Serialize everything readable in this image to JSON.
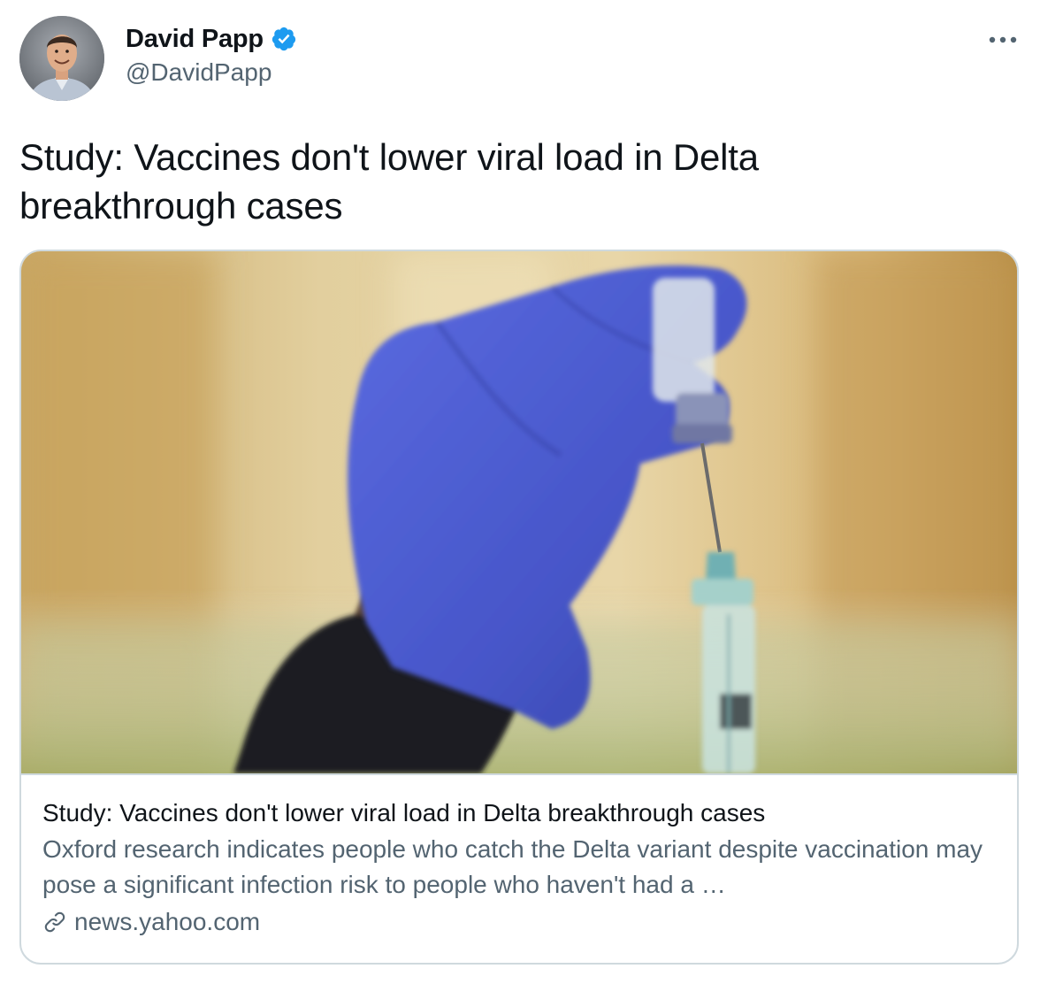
{
  "author": {
    "display_name": "David Papp",
    "handle": "@DavidPapp",
    "verified": true,
    "verified_color": "#1d9bf0"
  },
  "tweet": {
    "text": "Study: Vaccines don't lower viral load in Delta breakthrough cases"
  },
  "card": {
    "image_icon": "vaccine-syringe-photo",
    "title": "Study: Vaccines don't lower viral load in Delta breakthrough cases",
    "description": "Oxford research indicates people who catch the Delta variant despite vaccination may pose a significant infection risk to people who haven't had a …",
    "domain": "news.yahoo.com",
    "domain_icon": "link-icon"
  },
  "menu": {
    "icon": "more-options-icon"
  }
}
